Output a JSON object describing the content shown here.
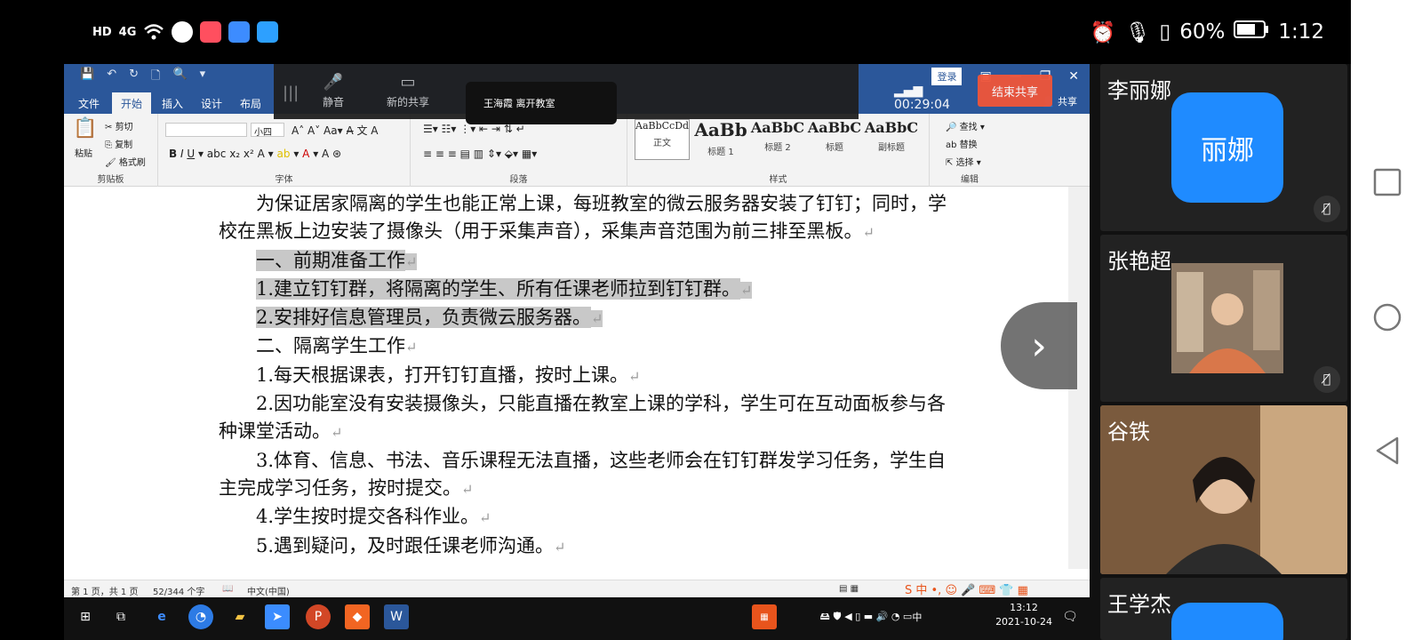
{
  "status_bar": {
    "left_icons": [
      "hd-icon",
      "signal-icon",
      "wifi-icon",
      "app-icon",
      "app-icon",
      "app-icon",
      "app-icon"
    ],
    "hd_text": "HD",
    "network_text": "4G",
    "battery_percent": "60%",
    "time": "1:12"
  },
  "word": {
    "menu_tabs": [
      "文件",
      "开始",
      "插入",
      "设计",
      "布局"
    ],
    "active_tab": "开始",
    "login_label": "登录",
    "share_label": "共享",
    "clipboard": {
      "paste": "粘贴",
      "cut": "剪切",
      "copy": "复制",
      "format_painter": "格式刷",
      "label": "剪贴板"
    },
    "font": {
      "font_size": "小四",
      "label": "字体"
    },
    "paragraph_label": "段落",
    "styles": {
      "label": "样式",
      "items": [
        {
          "sample": "AaBbCcDdI",
          "name": "正文"
        },
        {
          "sample": "AaBb",
          "name": "标题 1"
        },
        {
          "sample": "AaBbC",
          "name": "标题 2"
        },
        {
          "sample": "AaBbC",
          "name": "标题"
        },
        {
          "sample": "AaBbC",
          "name": "副标题"
        }
      ]
    },
    "editing": {
      "find": "查找",
      "replace": "替换",
      "select": "选择",
      "label": "编辑"
    },
    "document": {
      "paragraphs": [
        {
          "text": "为保证居家隔离的学生也能正常上课，每班教室的微云服务器安装了钉钉；同时，学校在黑板上边安装了摄像头（用于采集声音），采集声音范围为前三排至黑板。",
          "highlight": false
        },
        {
          "text": "一、前期准备工作",
          "highlight": true
        },
        {
          "text": "1.建立钉钉群，将隔离的学生、所有任课老师拉到钉钉群。",
          "highlight": true
        },
        {
          "text": "2.安排好信息管理员，负责微云服务器。",
          "highlight": true
        },
        {
          "text": "二、隔离学生工作",
          "highlight": false
        },
        {
          "text": "1.每天根据课表，打开钉钉直播，按时上课。",
          "highlight": false
        },
        {
          "text": "2.因功能室没有安装摄像头，只能直播在教室上课的学科，学生可在互动面板参与各种课堂活动。",
          "highlight": false
        },
        {
          "text": "3.体育、信息、书法、音乐课程无法直播，这些老师会在钉钉群发学习任务，学生自主完成学习任务，按时提交。",
          "highlight": false
        },
        {
          "text": "4.学生按时提交各科作业。",
          "highlight": false
        },
        {
          "text": "5.遇到疑问，及时跟任课老师沟通。",
          "highlight": false
        }
      ],
      "paragraph_mark": "↵"
    },
    "status_line": {
      "page": "第 1 页，共 1 页",
      "words": "52/344 个字",
      "language": "中文(中国)"
    }
  },
  "share_toolbar": {
    "mute_label": "静音",
    "new_share_label": "新的共享",
    "presenter_text": "王海霞 离开教室",
    "timer": "00:29:04",
    "end_share_label": "结束共享"
  },
  "taskbar": {
    "clock_time": "13:12",
    "clock_date": "2021-10-24",
    "ime_text": "中"
  },
  "participants": [
    {
      "name": "李丽娜",
      "avatar_text": "丽娜",
      "type": "avatar",
      "muted": true
    },
    {
      "name": "张艳超",
      "type": "video",
      "muted": true
    },
    {
      "name": "谷铁",
      "type": "video",
      "muted": false
    },
    {
      "name": "王学杰",
      "type": "avatar",
      "muted": false
    }
  ],
  "colors": {
    "word_blue": "#2b579a",
    "end_share": "#f0553a",
    "avatar_blue": "#1f8bff"
  }
}
